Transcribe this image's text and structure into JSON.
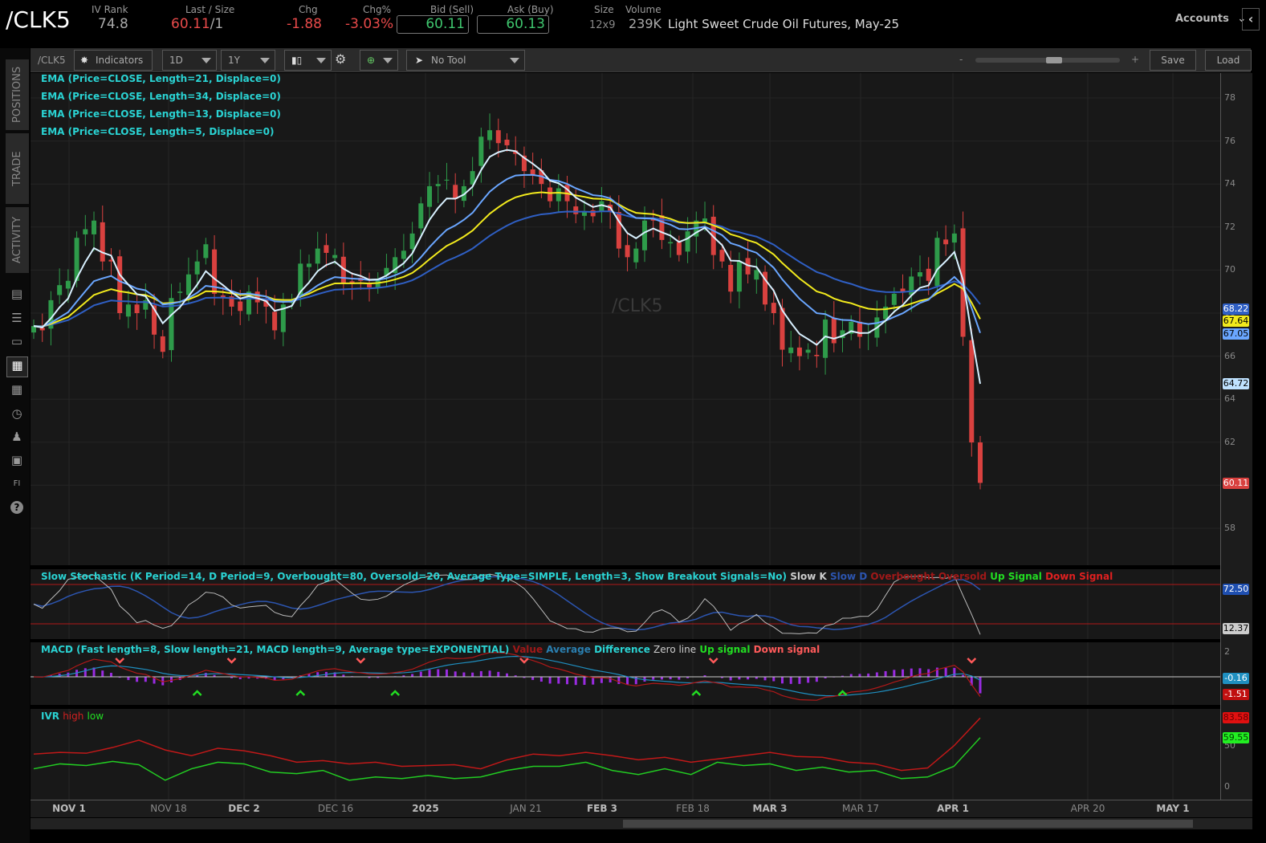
{
  "header": {
    "symbol": "/CLK5",
    "iv_rank_label": "IV Rank",
    "iv_rank": "74.8",
    "last_label": "Last / Size",
    "last": "60.11",
    "size": "/1",
    "chg_label": "Chg",
    "chg": "-1.88",
    "chgpct_label": "Chg%",
    "chgpct": "-3.03%",
    "bid_label": "Bid (Sell)",
    "bid": "60.11",
    "ask_label": "Ask (Buy)",
    "ask": "60.13",
    "size_label": "Size",
    "size_val": "12x9",
    "volume_label": "Volume",
    "volume": "239K",
    "description": "Light Sweet Crude Oil Futures, May-25",
    "accounts": "Accounts"
  },
  "toolbar": {
    "symbol": "/CLK5",
    "indicators": "Indicators",
    "aggregation": "1D",
    "range": "1Y",
    "tool": "No Tool",
    "zoom_minus": "-",
    "zoom_plus": "+",
    "save": "Save",
    "load": "Load",
    "zoom_level": 0.55
  },
  "sidebar": {
    "tabs": [
      "POSITIONS",
      "TRADE",
      "ACTIVITY"
    ],
    "icons": [
      "news-icon",
      "list-icon",
      "tv-icon",
      "chart-icon",
      "grid-icon",
      "dashboard-icon",
      "community-icon",
      "calendar-icon",
      "fi-icon",
      "help-icon"
    ]
  },
  "legends": {
    "ema21": "EMA (Price=CLOSE, Length=21, Displace=0)",
    "ema34": "EMA (Price=CLOSE, Length=34, Displace=0)",
    "ema13": "EMA (Price=CLOSE, Length=13, Displace=0)",
    "ema5": "EMA (Price=CLOSE, Length=5, Displace=0)",
    "stoch": "Slow Stochastic (K Period=14, D Period=9, Overbought=80, Oversold=20, Average Type=SIMPLE, Length=3, Show Breakout Signals=No)",
    "stoch_items": [
      "Slow K",
      "Slow D",
      "Overbought",
      "Oversold",
      "Up Signal",
      "Down Signal"
    ],
    "macd": "MACD (Fast length=8, Slow length=21, MACD length=9, Average type=EXPONENTIAL)",
    "macd_items": [
      "Value",
      "Average",
      "Difference",
      "Zero line",
      "Up signal",
      "Down signal"
    ],
    "ivr": "IVR",
    "ivr_items": [
      "high",
      "low"
    ]
  },
  "watermark": "/CLK5",
  "colors": {
    "up": "#2e9b4a",
    "down": "#d9413f",
    "ema34": "#2f5fc4",
    "ema21": "#f2ea1d",
    "ema13": "#6aa6ff",
    "ema5": "#d8f0ff"
  },
  "chart_data": {
    "type": "candlestick",
    "price_axis": {
      "ticks": [
        "78",
        "76",
        "74",
        "72",
        "70",
        "68",
        "66",
        "64",
        "62",
        "60",
        "58"
      ],
      "range": [
        57.5,
        79
      ]
    },
    "date_labels": [
      {
        "t": "NOV 1",
        "bold": true
      },
      {
        "t": "NOV 18"
      },
      {
        "t": "DEC 2",
        "bold": true
      },
      {
        "t": "DEC 16"
      },
      {
        "t": "2025",
        "bold": true
      },
      {
        "t": "JAN 21"
      },
      {
        "t": "FEB 3",
        "bold": true
      },
      {
        "t": "FEB 18"
      },
      {
        "t": "MAR 3",
        "bold": true
      },
      {
        "t": "MAR 17"
      },
      {
        "t": "APR 1",
        "bold": true
      },
      {
        "t": "APR 20"
      },
      {
        "t": "MAY 1",
        "bold": true
      }
    ],
    "closes": [
      67.4,
      67.2,
      68.6,
      69.3,
      69.5,
      71.5,
      71.9,
      72.3,
      70.4,
      70.4,
      68.0,
      68.4,
      68.0,
      68.6,
      67.0,
      66.2,
      68.7,
      69.0,
      69.8,
      70.4,
      71.2,
      68.9,
      68.7,
      68.3,
      68.1,
      69.0,
      68.5,
      68.3,
      67.2,
      68.4,
      68.6,
      70.3,
      70.3,
      71.0,
      70.8,
      70.7,
      69.4,
      69.4,
      69.5,
      69.2,
      69.6,
      70.1,
      70.6,
      70.9,
      71.7,
      73.1,
      73.9,
      74.0,
      74.2,
      73.3,
      73.9,
      74.6,
      76.2,
      76.5,
      75.9,
      75.8,
      75.4,
      74.6,
      74.4,
      74.0,
      73.2,
      73.8,
      73.2,
      72.6,
      72.7,
      72.5,
      73.2,
      72.7,
      71.0,
      70.6,
      71.0,
      72.3,
      72.3,
      71.4,
      71.3,
      70.7,
      71.8,
      72.3,
      72.4,
      70.7,
      70.4,
      69.0,
      70.4,
      69.8,
      70.0,
      68.4,
      68.0,
      66.3,
      66.4,
      66.0,
      66.3,
      66.0,
      67.7,
      66.6,
      67.2,
      67.6,
      66.9,
      67.1,
      67.8,
      68.3,
      68.9,
      69.0,
      69.7,
      69.9,
      69.5,
      71.5,
      71.2,
      71.7,
      66.9,
      61.99,
      60.11
    ],
    "last_values": {
      "ema34": "68.22",
      "ema21": "67.64",
      "ema13": "67.05",
      "ema5": "64.72",
      "last": "60.11"
    },
    "stoch": {
      "ticks": [
        "80",
        "20"
      ],
      "slow_d": "72.50",
      "slow_k": "12.37"
    },
    "macd": {
      "tick": "2",
      "average": "-0.16",
      "value": "-1.51"
    },
    "ivr": {
      "ticks": [
        "50",
        "0"
      ],
      "high_last": "83.58",
      "low_last": "59.55",
      "high": [
        40,
        42,
        41,
        48,
        57,
        45,
        38,
        47,
        44,
        38,
        30,
        32,
        28,
        30,
        25,
        26,
        27,
        22,
        33,
        40,
        38,
        42,
        38,
        33,
        36,
        30,
        34,
        38,
        42,
        37,
        36,
        30,
        28,
        20,
        23,
        50,
        84
      ],
      "low": [
        22,
        28,
        26,
        31,
        27,
        8,
        22,
        30,
        28,
        18,
        16,
        20,
        8,
        12,
        10,
        14,
        10,
        12,
        20,
        25,
        25,
        30,
        20,
        15,
        22,
        15,
        30,
        26,
        28,
        20,
        24,
        18,
        20,
        10,
        12,
        25,
        60
      ]
    }
  }
}
